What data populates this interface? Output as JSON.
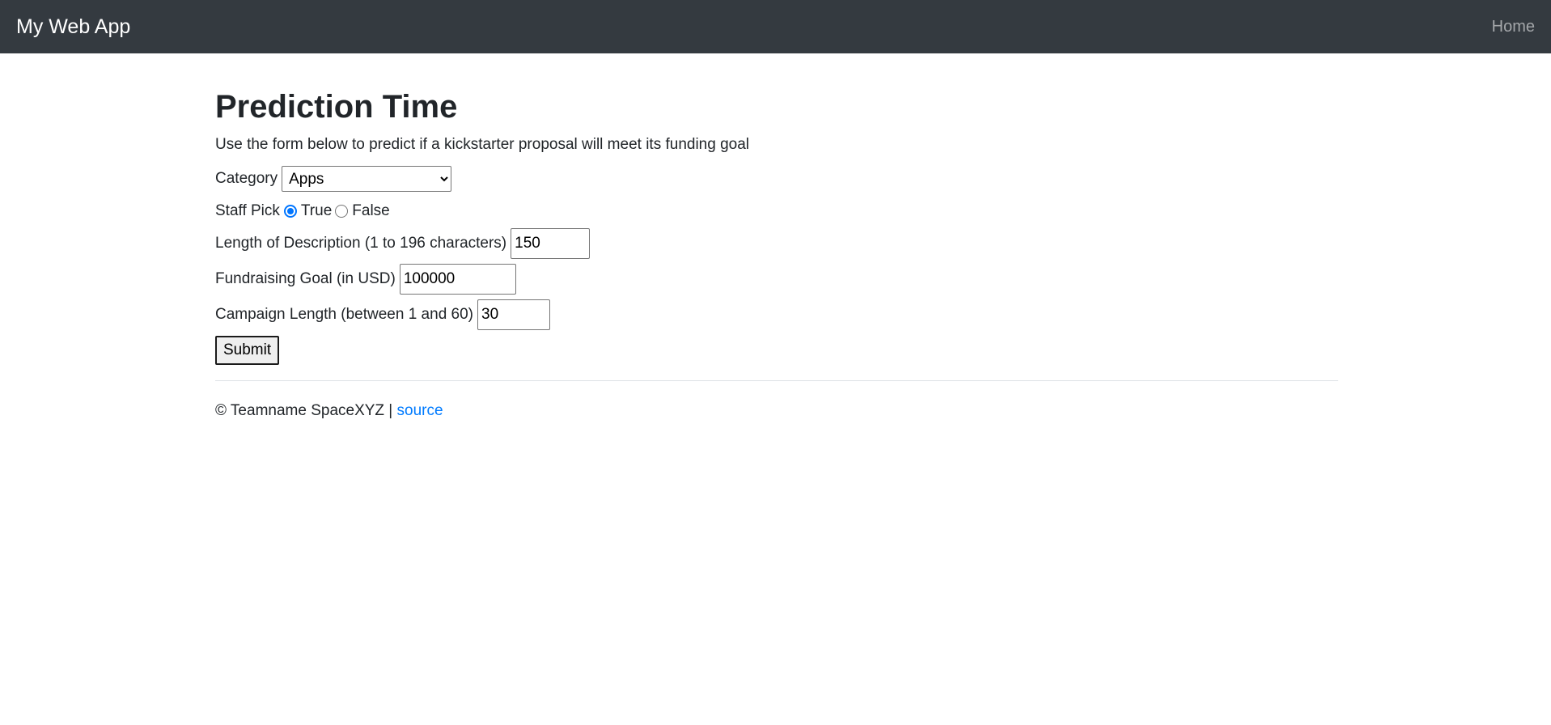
{
  "navbar": {
    "brand": "My Web App",
    "home_link": "Home"
  },
  "page": {
    "title": "Prediction Time",
    "lead": "Use the form below to predict if a kickstarter proposal will meet its funding goal"
  },
  "form": {
    "category": {
      "label": "Category",
      "selected": "Apps"
    },
    "staff_pick": {
      "label": "Staff Pick",
      "options": [
        {
          "label": "True",
          "checked": true
        },
        {
          "label": "False",
          "checked": false
        }
      ]
    },
    "description_length": {
      "label": "Length of Description (1 to 196 characters)",
      "value": "150"
    },
    "fundraising_goal": {
      "label": "Fundraising Goal (in USD)",
      "value": "100000"
    },
    "campaign_length": {
      "label": "Campaign Length (between 1 and 60)",
      "value": "30"
    },
    "submit_label": "Submit"
  },
  "footer": {
    "copyright": "© Teamname SpaceXYZ |",
    "source_link": "source"
  },
  "colors": {
    "navbar_bg": "#343a40",
    "link": "#007bff",
    "radio_accent": "#0075ff"
  }
}
